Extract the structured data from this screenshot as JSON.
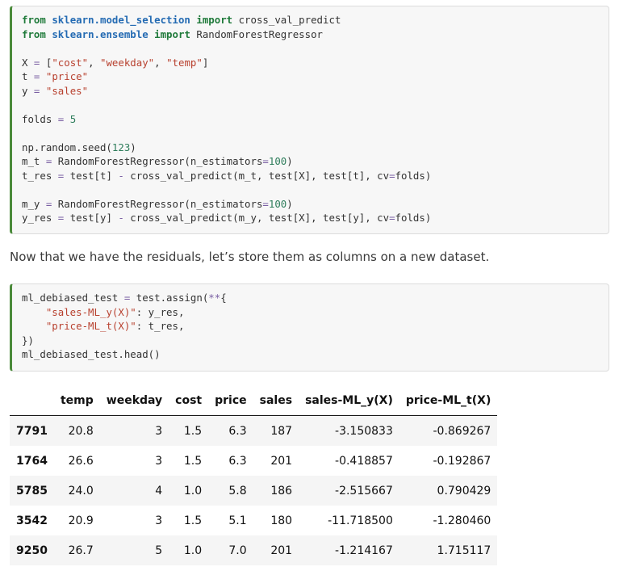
{
  "code_block_1": {
    "lines": [
      [
        [
          "kw",
          "from"
        ],
        [
          "t",
          " "
        ],
        [
          "mod",
          "sklearn.model_selection"
        ],
        [
          "t",
          " "
        ],
        [
          "kw",
          "import"
        ],
        [
          "t",
          " cross_val_predict"
        ]
      ],
      [
        [
          "kw",
          "from"
        ],
        [
          "t",
          " "
        ],
        [
          "mod",
          "sklearn.ensemble"
        ],
        [
          "t",
          " "
        ],
        [
          "kw",
          "import"
        ],
        [
          "t",
          " RandomForestRegressor"
        ]
      ],
      [],
      [
        [
          "t",
          "X "
        ],
        [
          "op",
          "="
        ],
        [
          "t",
          " ["
        ],
        [
          "str",
          "\"cost\""
        ],
        [
          "t",
          ", "
        ],
        [
          "str",
          "\"weekday\""
        ],
        [
          "t",
          ", "
        ],
        [
          "str",
          "\"temp\""
        ],
        [
          "t",
          "]"
        ]
      ],
      [
        [
          "t",
          "t "
        ],
        [
          "op",
          "="
        ],
        [
          "t",
          " "
        ],
        [
          "str",
          "\"price\""
        ]
      ],
      [
        [
          "t",
          "y "
        ],
        [
          "op",
          "="
        ],
        [
          "t",
          " "
        ],
        [
          "str",
          "\"sales\""
        ]
      ],
      [],
      [
        [
          "t",
          "folds "
        ],
        [
          "op",
          "="
        ],
        [
          "t",
          " "
        ],
        [
          "num",
          "5"
        ]
      ],
      [],
      [
        [
          "t",
          "np.random.seed("
        ],
        [
          "num",
          "123"
        ],
        [
          "t",
          ")"
        ]
      ],
      [
        [
          "t",
          "m_t "
        ],
        [
          "op",
          "="
        ],
        [
          "t",
          " RandomForestRegressor(n_estimators"
        ],
        [
          "op",
          "="
        ],
        [
          "num",
          "100"
        ],
        [
          "t",
          ")"
        ]
      ],
      [
        [
          "t",
          "t_res "
        ],
        [
          "op",
          "="
        ],
        [
          "t",
          " test[t] "
        ],
        [
          "op",
          "-"
        ],
        [
          "t",
          " cross_val_predict(m_t, test[X], test[t], cv"
        ],
        [
          "op",
          "="
        ],
        [
          "t",
          "folds)"
        ]
      ],
      [],
      [
        [
          "t",
          "m_y "
        ],
        [
          "op",
          "="
        ],
        [
          "t",
          " RandomForestRegressor(n_estimators"
        ],
        [
          "op",
          "="
        ],
        [
          "num",
          "100"
        ],
        [
          "t",
          ")"
        ]
      ],
      [
        [
          "t",
          "y_res "
        ],
        [
          "op",
          "="
        ],
        [
          "t",
          " test[y] "
        ],
        [
          "op",
          "-"
        ],
        [
          "t",
          " cross_val_predict(m_y, test[X], test[y], cv"
        ],
        [
          "op",
          "="
        ],
        [
          "t",
          "folds)"
        ]
      ]
    ]
  },
  "prose": {
    "text": "Now that we have the residuals, let’s store them as columns on a new dataset."
  },
  "code_block_2": {
    "lines": [
      [
        [
          "t",
          "ml_debiased_test "
        ],
        [
          "op",
          "="
        ],
        [
          "t",
          " test.assign("
        ],
        [
          "op",
          "**"
        ],
        [
          "t",
          "{"
        ]
      ],
      [
        [
          "t",
          "    "
        ],
        [
          "str",
          "\"sales-ML_y(X)\""
        ],
        [
          "t",
          ": y_res,"
        ]
      ],
      [
        [
          "t",
          "    "
        ],
        [
          "str",
          "\"price-ML_t(X)\""
        ],
        [
          "t",
          ": t_res,"
        ]
      ],
      [
        [
          "t",
          "})"
        ]
      ],
      [
        [
          "t",
          "ml_debiased_test.head()"
        ]
      ]
    ]
  },
  "dataframe": {
    "columns": [
      "",
      "temp",
      "weekday",
      "cost",
      "price",
      "sales",
      "sales-ML_y(X)",
      "price-ML_t(X)"
    ],
    "rows": [
      {
        "index": "7791",
        "values": [
          "20.8",
          "3",
          "1.5",
          "6.3",
          "187",
          "-3.150833",
          "-0.869267"
        ]
      },
      {
        "index": "1764",
        "values": [
          "26.6",
          "3",
          "1.5",
          "6.3",
          "201",
          "-0.418857",
          "-0.192867"
        ]
      },
      {
        "index": "5785",
        "values": [
          "24.0",
          "4",
          "1.0",
          "5.8",
          "186",
          "-2.515667",
          "0.790429"
        ]
      },
      {
        "index": "3542",
        "values": [
          "20.9",
          "3",
          "1.5",
          "5.1",
          "180",
          "-11.718500",
          "-1.280460"
        ]
      },
      {
        "index": "9250",
        "values": [
          "26.7",
          "5",
          "1.0",
          "7.0",
          "201",
          "-1.214167",
          "1.715117"
        ]
      }
    ]
  }
}
